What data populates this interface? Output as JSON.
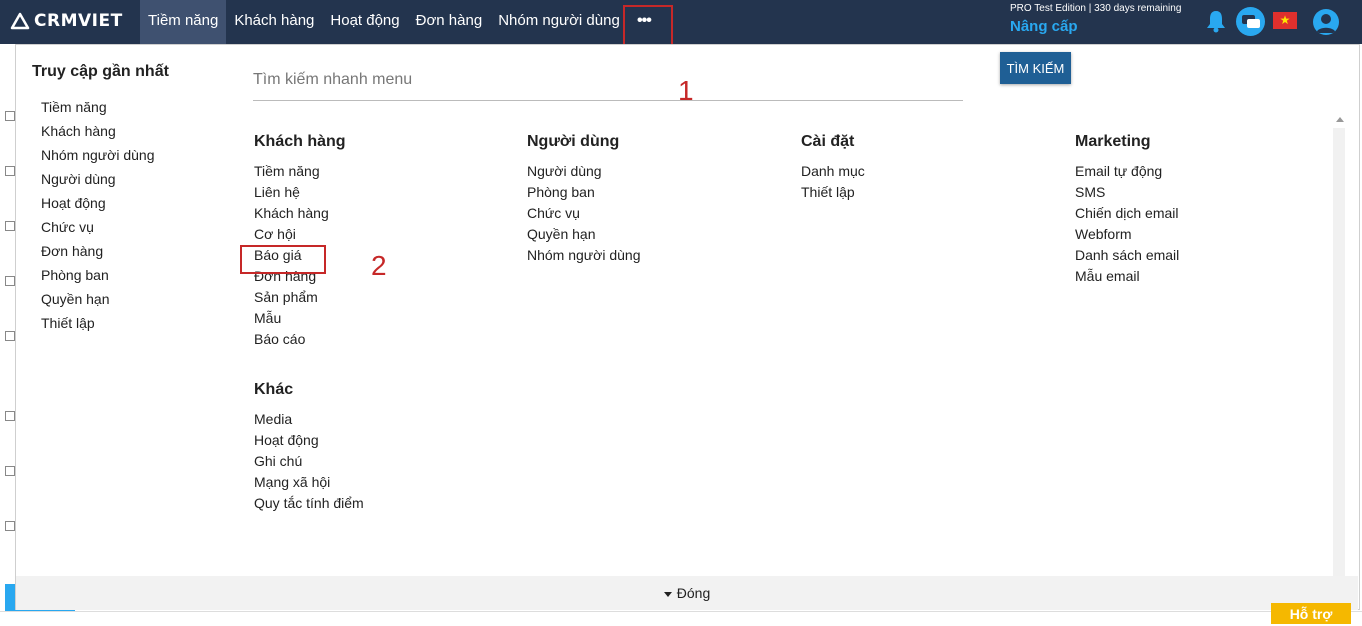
{
  "header": {
    "logo": "CRMVIET",
    "nav": [
      {
        "label": "Tiềm năng",
        "active": true
      },
      {
        "label": "Khách hàng"
      },
      {
        "label": "Hoạt động"
      },
      {
        "label": "Đơn hàng"
      },
      {
        "label": "Nhóm người dùng"
      }
    ],
    "more_label": "•••",
    "edition": "PRO Test Edition | 330 days remaining",
    "upgrade": "Nâng cấp",
    "flag_symbol": "★"
  },
  "recent": {
    "title": "Truy cập gần nhất",
    "items": [
      "Tiềm năng",
      "Khách hàng",
      "Nhóm người dùng",
      "Người dùng",
      "Hoạt động",
      "Chức vụ",
      "Đơn hàng",
      "Phòng ban",
      "Quyền hạn",
      "Thiết lập"
    ]
  },
  "search": {
    "placeholder": "Tìm kiếm nhanh menu",
    "button": "TÌM KIẾM"
  },
  "annotations": {
    "one": "1",
    "two": "2"
  },
  "menu": {
    "khach_hang": {
      "title": "Khách hàng",
      "items": [
        "Tiềm năng",
        "Liên hệ",
        "Khách hàng",
        "Cơ hội",
        "Báo giá",
        "Đơn hàng",
        "Sản phẩm",
        "Mẫu",
        "Báo cáo"
      ]
    },
    "khac": {
      "title": "Khác",
      "items": [
        "Media",
        "Hoạt động",
        "Ghi chú",
        "Mạng xã hội",
        "Quy tắc tính điểm"
      ]
    },
    "nguoi_dung": {
      "title": "Người dùng",
      "items": [
        "Người dùng",
        "Phòng ban",
        "Chức vụ",
        "Quyền hạn",
        "Nhóm người dùng"
      ]
    },
    "cai_dat": {
      "title": "Cài đặt",
      "items": [
        "Danh mục",
        "Thiết lập"
      ]
    },
    "marketing": {
      "title": "Marketing",
      "items": [
        "Email tự động",
        "SMS",
        "Chiến dịch email",
        "Webform",
        "Danh sách email",
        "Mẫu email"
      ]
    }
  },
  "footer": {
    "close": "Đóng"
  },
  "help": "Hỗ trợ",
  "colors": {
    "topbar": "#23344e",
    "accent": "#29a8f0",
    "annotation": "#c62828",
    "help": "#f5b800"
  }
}
